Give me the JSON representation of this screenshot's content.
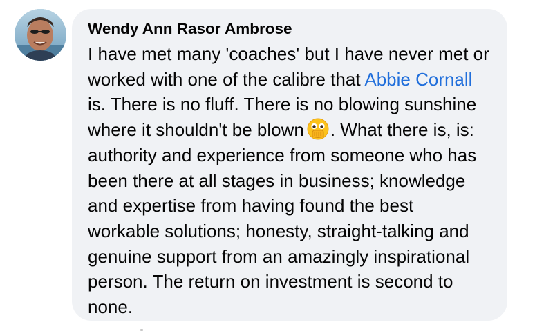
{
  "comment": {
    "author": "Wendy Ann Rasor Ambrose",
    "text_before_mention": "I have met many 'coaches' but I have never met or worked with one of the calibre that ",
    "mention": "Abbie Cornall",
    "text_after_mention": " is. There is no fluff. There is no blowing sunshine where it shouldn't be blown",
    "emoji": "face-with-open-eyes-and-hand-over-mouth-emoji",
    "text_after_emoji": ". What there is, is: authority and experience from someone who has been there at all stages in business; knowledge and expertise from having found the best workable solutions; honesty, straight-talking and genuine support from an amazingly inspirational person. The return on investment is second to none."
  },
  "colors": {
    "bubble_background": "#f0f2f5",
    "text": "#050505",
    "mention_link": "#216fdb"
  }
}
